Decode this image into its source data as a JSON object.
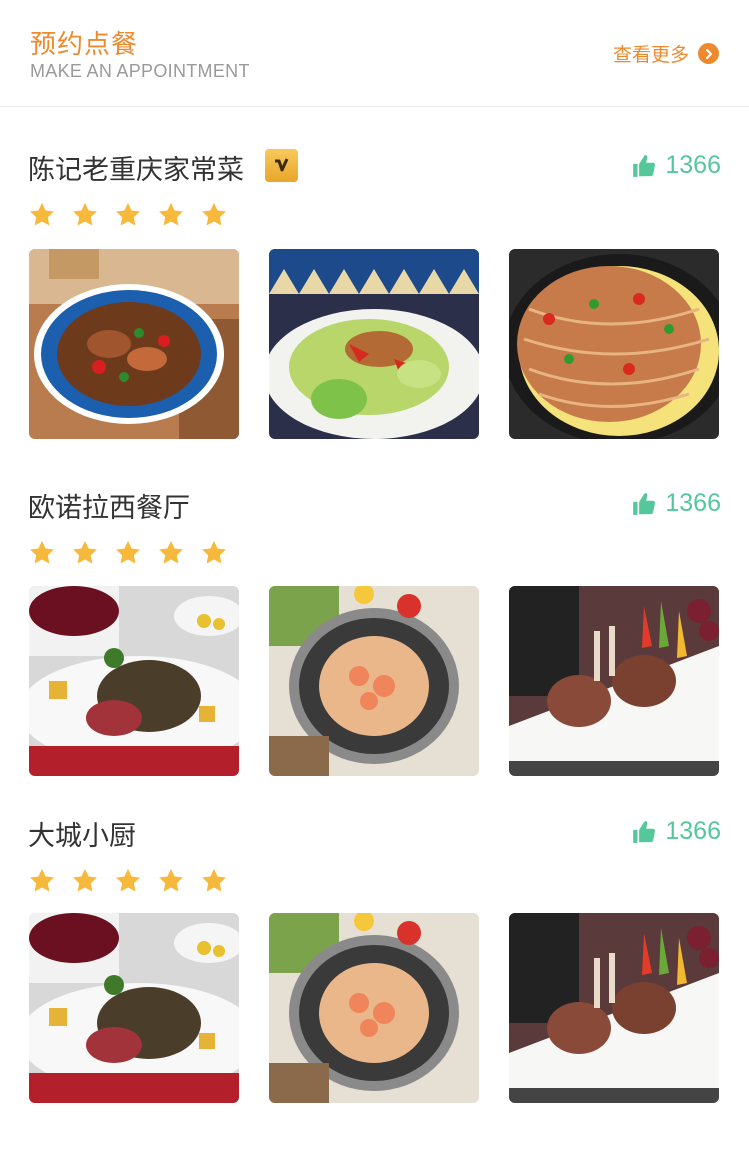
{
  "header": {
    "title": "预约点餐",
    "subtitle": "MAKE AN APPOINTMENT",
    "more_label": "查看更多"
  },
  "restaurants": [
    {
      "name": "陈记老重庆家常菜",
      "verified_badge": "V",
      "likes": "1366",
      "rating": 5,
      "photos": [
        "twice-cooked-pork-dish",
        "stir-fried-cabbage-pork",
        "glass-noodles-minced-meat"
      ]
    },
    {
      "name": "欧诺拉西餐厅",
      "likes": "1366",
      "rating": 5,
      "photos": [
        "steak-with-red-wine",
        "shrimp-pasta-bowl",
        "lamb-rack-with-peppers"
      ]
    },
    {
      "name": "大城小厨",
      "likes": "1366",
      "rating": 5,
      "photos": [
        "steak-with-red-wine",
        "shrimp-pasta-bowl",
        "lamb-rack-with-peppers"
      ]
    }
  ],
  "colors": {
    "accent": "#ee8a2e",
    "likes": "#54c79b",
    "star": "#f6b93b",
    "divider": "#ececec"
  },
  "icons": {
    "more": "chevron-right-icon",
    "like": "thumbs-up-icon",
    "rating": "star-icon",
    "verified": "verified-badge-icon"
  }
}
